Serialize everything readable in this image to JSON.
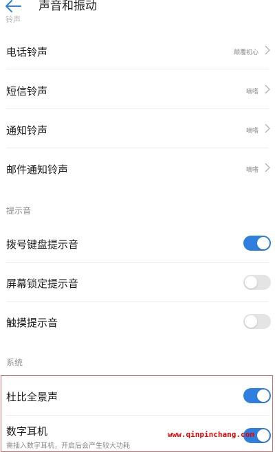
{
  "header": {
    "title": "声音和振动"
  },
  "ringtones": {
    "faded_heading": "铃声",
    "items": [
      {
        "label": "电话铃声",
        "value": "颠覆初心"
      },
      {
        "label": "短信铃声",
        "value": "嘀嗒"
      },
      {
        "label": "通知铃声",
        "value": "嘀嗒"
      },
      {
        "label": "邮件通知铃声",
        "value": "嘀嗒"
      }
    ]
  },
  "tones": {
    "title": "提示音",
    "items": [
      {
        "label": "拨号键盘提示音",
        "on": true
      },
      {
        "label": "屏幕锁定提示音",
        "on": false
      },
      {
        "label": "触摸提示音",
        "on": false
      }
    ]
  },
  "system": {
    "title": "系统",
    "items": [
      {
        "label": "杜比全景声",
        "on": true
      },
      {
        "label": "数字耳机",
        "subtext": "需插入数字耳机，开启后会产生较大功耗",
        "on": true
      }
    ]
  },
  "watermark": {
    "text": "www.qinpinchang.com"
  },
  "colors": {
    "accent": "#2f7fe0",
    "highlight_border": "#e06a6a",
    "watermark": "#e60000"
  }
}
